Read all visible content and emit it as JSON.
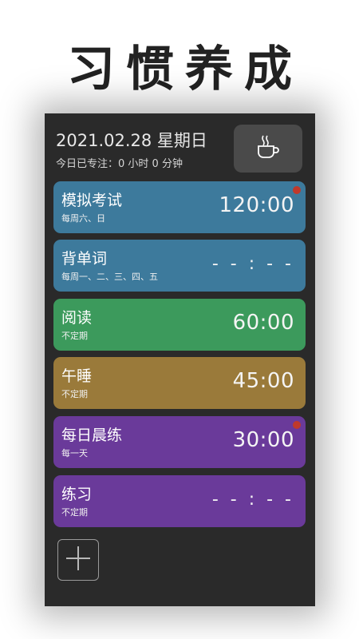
{
  "headline": "习惯养成",
  "header": {
    "date": "2021.02.28 星期日",
    "focus_text": "今日已专注：0 小时 0 分钟",
    "coffee_icon": "coffee-cup-icon"
  },
  "habits": [
    {
      "name": "模拟考试",
      "schedule": "每周六、日",
      "time": "120:00",
      "color": "#3d7a9c",
      "badge": true
    },
    {
      "name": "背单词",
      "schedule": "每周一、二、三、四、五",
      "time": "- - : - -",
      "color": "#3d7a9c",
      "badge": false
    },
    {
      "name": "阅读",
      "schedule": "不定期",
      "time": "60:00",
      "color": "#3c9a5c",
      "badge": false
    },
    {
      "name": "午睡",
      "schedule": "不定期",
      "time": "45:00",
      "color": "#9a7a3a",
      "badge": false
    },
    {
      "name": "每日晨练",
      "schedule": "每一天",
      "time": "30:00",
      "color": "#6a3a9a",
      "badge": true
    },
    {
      "name": "练习",
      "schedule": "不定期",
      "time": "- - : - -",
      "color": "#6a3a9a",
      "badge": false
    }
  ],
  "add_icon": "plus-icon"
}
